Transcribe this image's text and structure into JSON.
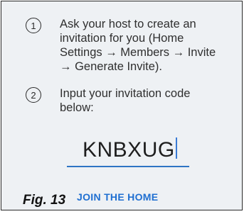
{
  "steps": [
    {
      "number": "1",
      "text": "Ask your host to create an invitation for you (Home Settings → Members → Invite → Generate Invite)."
    },
    {
      "number": "2",
      "text": "Input your invitation code below:"
    }
  ],
  "invite_code": {
    "value": "KNBXUG"
  },
  "footer": {
    "figure_label": "Fig. 13",
    "join_button_label": "JOIN THE HOME"
  },
  "colors": {
    "accent": "#1f6fd1",
    "underline": "#2e74c4",
    "background": "#eef1f4"
  }
}
